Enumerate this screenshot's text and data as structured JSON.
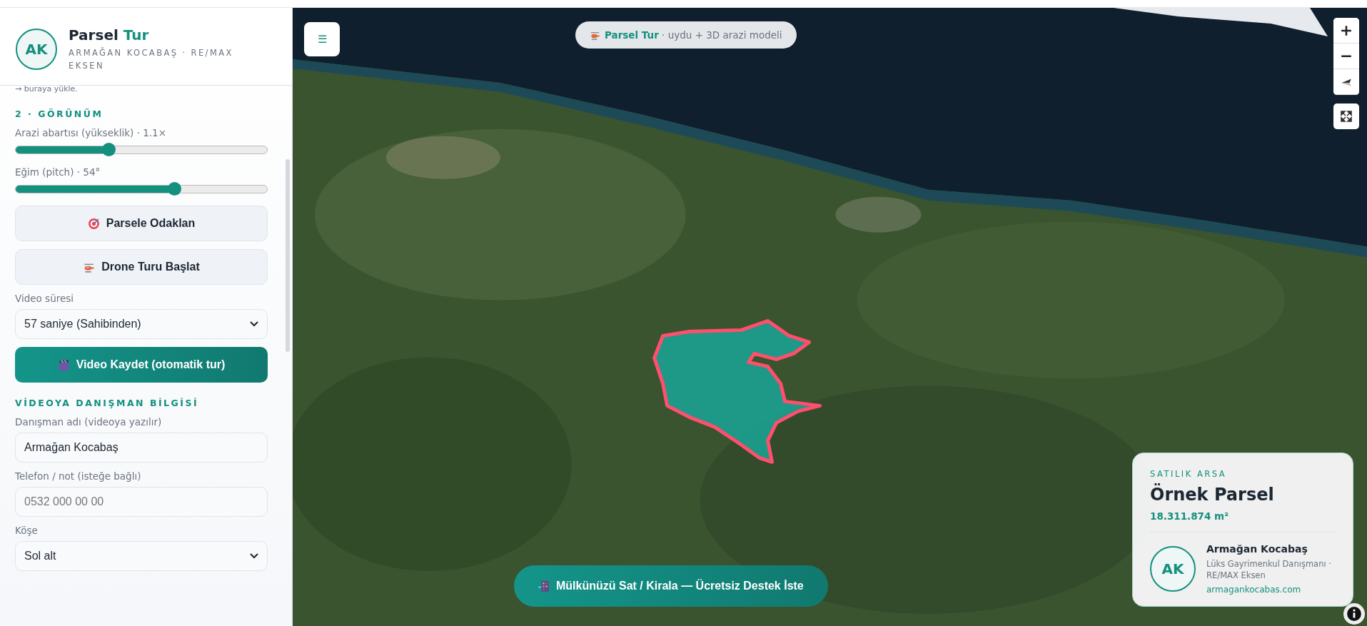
{
  "sidebar": {
    "avatar": "AK",
    "title": {
      "text": "Parsel",
      "accent": "Tur"
    },
    "subtitle": "ARMAĞAN KOCABAŞ · RE/MAX EKSEN",
    "upload_hint": "→ buraya yükle.",
    "sections": [
      {
        "kind": "heading",
        "text": "2 · GÖRÜNÜM"
      },
      {
        "kind": "slider",
        "label": "Arazi abartısı (yükseklik) · 1.1×",
        "level": 0.37
      },
      {
        "kind": "slider",
        "label": "Eğim (pitch) · 54°",
        "level": 0.63
      },
      {
        "kind": "focus",
        "label": "Parsele Odaklan"
      },
      {
        "kind": "drone",
        "label": "Drone Turu Başlat"
      },
      {
        "kind": "select",
        "label": "Video süresi",
        "value": "57 saniye (Sahibinden)"
      },
      {
        "kind": "primary",
        "label": "Video Kaydet (otomatik tur)"
      },
      {
        "kind": "heading",
        "text": "VİDEOYA DANIŞMAN BİLGİSİ"
      },
      {
        "kind": "input",
        "label": "Danışman adı (videoya yazılır)",
        "value": "Armağan Kocabaş"
      },
      {
        "kind": "input",
        "label": "Telefon / not (isteğe bağlı)",
        "placeholder": "0532 000 00 00"
      },
      {
        "kind": "select",
        "label": "Köşe",
        "value": "Sol alt"
      }
    ]
  },
  "map": {
    "menu_button": "☰",
    "banner": "**Parsel Tur** · uydu + 3D arazi modeli",
    "card": {
      "eyebrow": "SATILIK ARSA",
      "title": "Örnek Parsel",
      "area": "18.311.874 m²",
      "avatar": "AK",
      "name": "Armağan Kocabaş",
      "role": "Lüks Gayrimenkul Danışmanı · RE/MAX Eksen",
      "website": "armagankocabas.com"
    },
    "cta": "Mülkünüzü Sat / Kirala — Ücretsiz Destek İste"
  }
}
